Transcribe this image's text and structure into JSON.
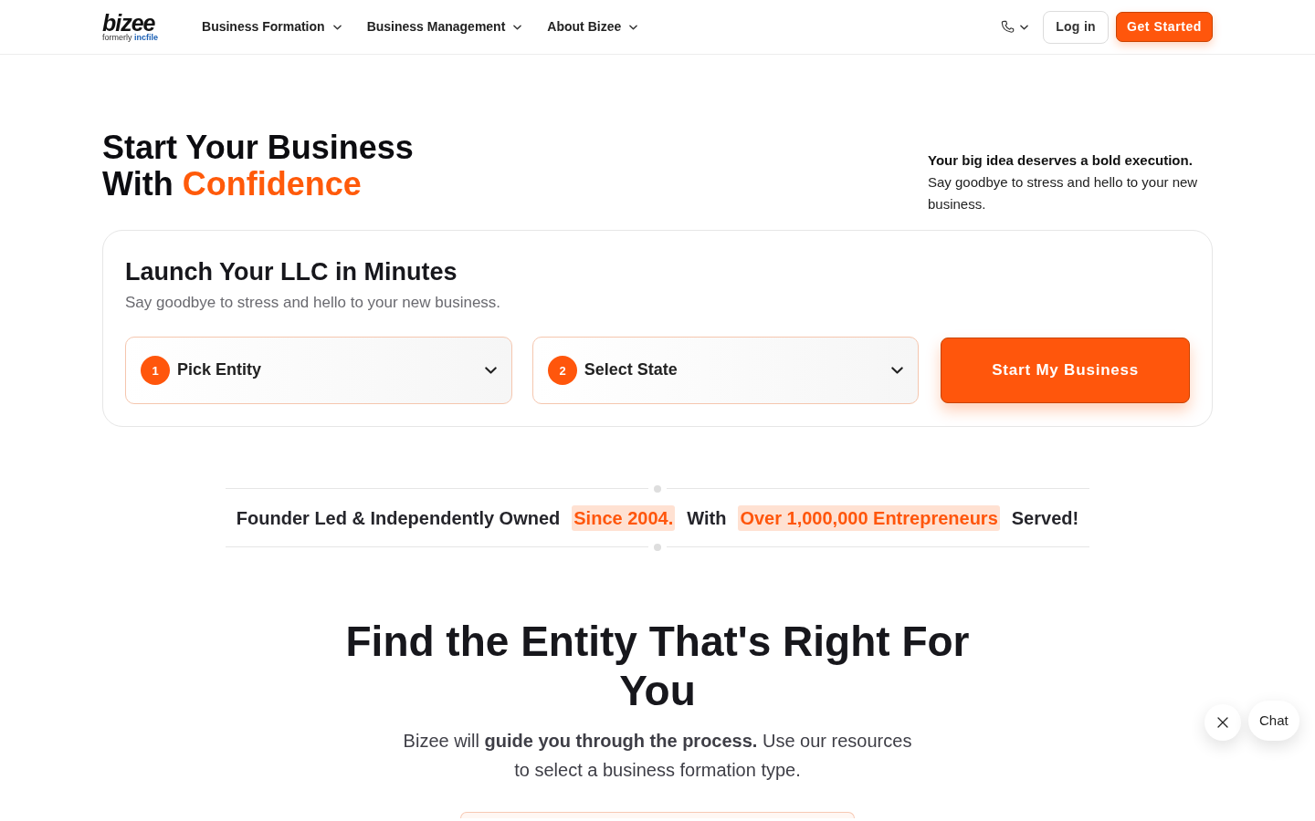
{
  "header": {
    "logo": {
      "wordmark": "bizee",
      "tagline": "formerly",
      "tagline_brand": "incfile"
    },
    "nav": [
      {
        "label": "Business Formation"
      },
      {
        "label": "Business Management"
      },
      {
        "label": "About Bizee"
      }
    ],
    "login": "Log in",
    "cta": "Get Started"
  },
  "hero": {
    "title_lines": [
      [
        {
          "text": "Start Your Business",
          "accent": false
        }
      ],
      [
        {
          "text": "With",
          "accent": false
        },
        {
          "text": "Confidence",
          "accent": true
        }
      ]
    ],
    "aside": "**Your big idea deserves a bold execution.** Say goodbye to stress and hello to your new business."
  },
  "launch_card": {
    "title": "Launch Your LLC in Minutes",
    "subtitle": "Say goodbye to stress and hello to your new business.",
    "selects": [
      {
        "step": "1",
        "label": "Pick Entity"
      },
      {
        "step": "2",
        "label": "Select State"
      }
    ],
    "button": "Start My Business"
  },
  "stats_strip": [
    {
      "text": "Founder Led & Independently Owned",
      "highlight": false
    },
    {
      "text": "Since 2004.",
      "highlight": true
    },
    {
      "text": "With",
      "highlight": false
    },
    {
      "text": "Over 1,000,000 Entrepreneurs",
      "highlight": true
    },
    {
      "text": "Served!",
      "highlight": false
    }
  ],
  "entity_section": {
    "title": "Find the Entity That's Right For You",
    "description": "Bizee will **guide you through the process.** Use our resources to select a business formation type."
  },
  "chat": {
    "label": "Chat"
  }
}
